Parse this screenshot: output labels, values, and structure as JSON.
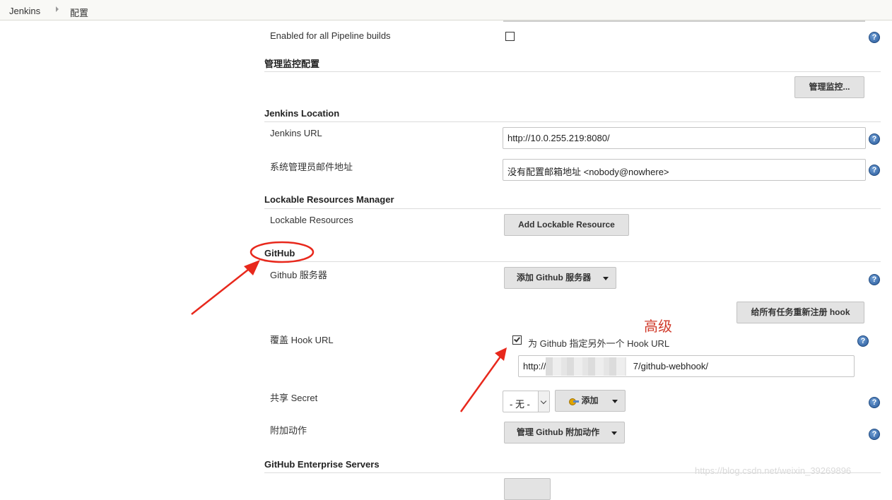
{
  "breadcrumb": {
    "root": "Jenkins",
    "current": "配置"
  },
  "pipeline": {
    "label": "Enabled for all Pipeline builds",
    "checked": false
  },
  "monitor": {
    "title": "管理监控配置",
    "button": "管理监控..."
  },
  "location": {
    "title": "Jenkins Location",
    "url_label": "Jenkins URL",
    "url_value": "http://10.0.255.219:8080/",
    "email_label": "系统管理员邮件地址",
    "email_value": "没有配置邮箱地址 <nobody@nowhere>"
  },
  "lockable": {
    "title": "Lockable Resources Manager",
    "label": "Lockable Resources",
    "button": "Add Lockable Resource"
  },
  "github": {
    "title": "GitHub",
    "servers_label": "Github 服务器",
    "add_server_button": "添加 Github 服务器",
    "reregister_button": "给所有任务重新注册 hook",
    "hook_label": "覆盖 Hook URL",
    "hook_checkbox_label": "为 Github 指定另外一个 Hook URL",
    "hook_checked": true,
    "hook_url_prefix": "http://",
    "hook_url_suffix": "7/github-webhook/",
    "secret_label": "共享 Secret",
    "secret_select": "- 无 -",
    "secret_add_button": "添加",
    "extra_label": "附加动作",
    "extra_button": "管理 Github 附加动作"
  },
  "enterprise": {
    "title": "GitHub Enterprise Servers"
  },
  "annotation": {
    "text": "高级",
    "color": "#d03a2a"
  },
  "watermark": "https://blog.csdn.net/weixin_39269896",
  "help_glyph": "?",
  "icons": [
    "help-icon",
    "key-icon",
    "dropdown-caret-icon",
    "checkbox-icon"
  ]
}
